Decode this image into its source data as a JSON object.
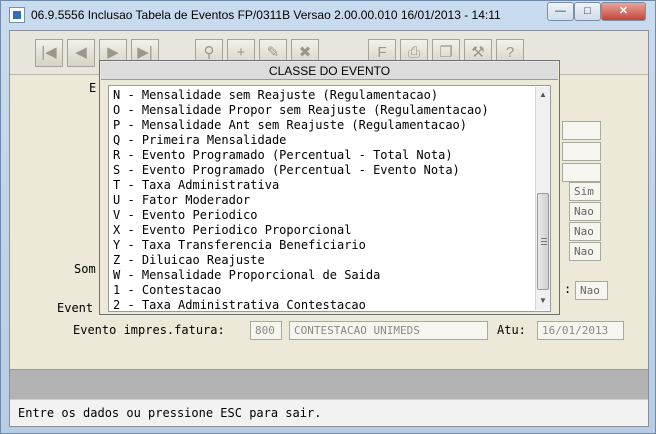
{
  "window": {
    "title": "06.9.5556  Inclusao  Tabela de Eventos FP/0311B Versao 2.00.00.010 16/01/2013 - 14:11",
    "minimize": "—",
    "maximize": "□",
    "close": "✕"
  },
  "toolbar": {
    "buttons": [
      {
        "name": "first-record-icon",
        "glyph": "|◀"
      },
      {
        "name": "previous-record-icon",
        "glyph": "◀"
      },
      {
        "name": "next-record-icon",
        "glyph": "▶"
      },
      {
        "name": "last-record-icon",
        "glyph": "▶|"
      },
      {
        "name": "search-icon",
        "glyph": "⚲"
      },
      {
        "name": "add-icon",
        "glyph": "+"
      },
      {
        "name": "edit-icon",
        "glyph": "✎"
      },
      {
        "name": "delete-icon",
        "glyph": "✖"
      },
      {
        "name": "filter-icon",
        "glyph": "F"
      },
      {
        "name": "print-icon",
        "glyph": "⎙"
      },
      {
        "name": "copy-icon",
        "glyph": "❐"
      },
      {
        "name": "tools-icon",
        "glyph": "⚒"
      },
      {
        "name": "help-icon",
        "glyph": "?"
      }
    ]
  },
  "form": {
    "label_e": "E",
    "label_som": "Som",
    "label_event": "Event",
    "label_evento_impres": "Evento impres.fatura:",
    "evento_impres_code": "800",
    "evento_impres_desc": "CONTESTACAO UNIMEDS",
    "label_atu": "Atu:",
    "atu_value": "16/01/2013",
    "sim_nao": [
      "Sim",
      "Nao",
      "Nao",
      "Nao"
    ],
    "colon": ":",
    "nao_bottom": "Nao"
  },
  "popup": {
    "title": "CLASSE DO EVENTO",
    "items": [
      "N - Mensalidade sem Reajuste (Regulamentacao)",
      "O - Mensalidade Propor sem Reajuste (Regulamentacao)",
      "P - Mensalidade Ant sem Reajuste (Regulamentacao)",
      "Q - Primeira Mensalidade",
      "R - Evento Programado (Percentual - Total Nota)",
      "S - Evento Programado (Percentual - Evento Nota)",
      "T - Taxa Administrativa",
      "U - Fator Moderador",
      "V - Evento Periodico",
      "X - Evento Periodico Proporcional",
      "Y - Taxa Transferencia Beneficiario",
      "Z - Diluicao Reajuste",
      "W - Mensalidade Proporcional de Saida",
      "1 - Contestacao",
      "2 - Taxa Administrativa Contestacao"
    ],
    "scroll_up": "▲",
    "scroll_down": "▼"
  },
  "status": {
    "message": "Entre os dados ou pressione ESC para sair."
  }
}
